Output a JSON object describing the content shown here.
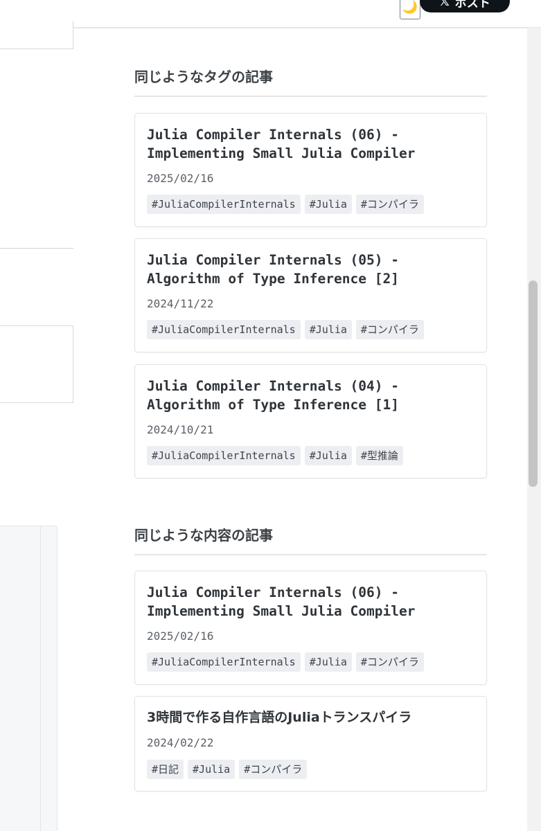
{
  "header": {
    "theme_icon": "crescent-moon-icon",
    "theme_glyph": "🌙",
    "post_button_label": "ポスト",
    "post_button_icon": "x-logo-icon",
    "x_glyph": "𝕏"
  },
  "similar_tags": {
    "heading": "同じようなタグの記事",
    "articles": [
      {
        "title_line1": "Julia Compiler Internals (06) -",
        "title_line2": "Implementing Small Julia Compiler",
        "date": "2025/02/16",
        "tags": [
          "#JuliaCompilerInternals",
          "#Julia",
          "#コンパイラ"
        ]
      },
      {
        "title_line1": "Julia Compiler Internals (05) -",
        "title_line2": "Algorithm of Type Inference [2]",
        "date": "2024/11/22",
        "tags": [
          "#JuliaCompilerInternals",
          "#Julia",
          "#コンパイラ"
        ]
      },
      {
        "title_line1": "Julia Compiler Internals (04) -",
        "title_line2": "Algorithm of Type Inference [1]",
        "date": "2024/10/21",
        "tags": [
          "#JuliaCompilerInternals",
          "#Julia",
          "#型推論"
        ]
      }
    ]
  },
  "similar_content": {
    "heading": "同じような内容の記事",
    "articles": [
      {
        "title_line1": "Julia Compiler Internals (06) -",
        "title_line2": "Implementing Small Julia Compiler",
        "date": "2025/02/16",
        "tags": [
          "#JuliaCompilerInternals",
          "#Julia",
          "#コンパイラ"
        ]
      },
      {
        "title_line1": "3時間で作る自作言語のJuliaトランスパイラ",
        "title_line2": "",
        "date": "2024/02/22",
        "tags": [
          "#日記",
          "#Julia",
          "#コンパイラ"
        ]
      }
    ]
  }
}
